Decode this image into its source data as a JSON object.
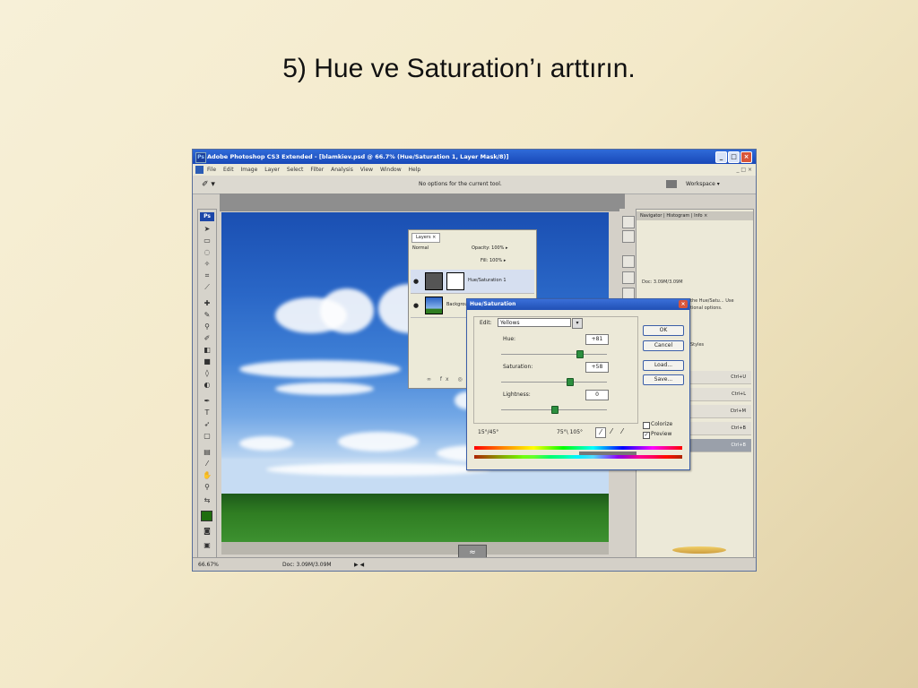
{
  "slide": {
    "title": "5) Hue ve Saturation’ı arttırın."
  },
  "app": {
    "title": "Adobe Photoshop CS3 Extended - [blamkiev.psd @ 66.7% (Hue/Saturation 1, Layer Mask/8)]",
    "logo": "Ps",
    "window_buttons": {
      "minimize": "_",
      "maximize": "□",
      "close": "×"
    },
    "menu": [
      "File",
      "Edit",
      "Image",
      "Layer",
      "Select",
      "Filter",
      "Analysis",
      "View",
      "Window",
      "Help"
    ],
    "menu_right": "_ □ ×",
    "options_hint": "No options for the current tool.",
    "workspace_label": "Workspace ▾",
    "tool_preset": "✐ ▾"
  },
  "status": {
    "zoom": "66.67%",
    "doc": "Doc: 3.09M/3.09M",
    "nav": "▶ ◀"
  },
  "scroll_handle": "≈",
  "layers_panel": {
    "tab": "Layers ×",
    "blend_mode": "Normal",
    "opacity_label": "Opacity: 100% ▸",
    "fill_label": "Fill: 100% ▸",
    "items": [
      {
        "name": "Hue/Saturation 1",
        "selected": true
      },
      {
        "name": "Background",
        "selected": false
      }
    ],
    "footer": "∞ fx ◎ ▣ ▤ ⌫"
  },
  "right_panel": {
    "tabs": "Navigator | Histogram | Info ×",
    "info_note": "Doc: 3.09M/3.09M",
    "hint_lines": [
      "the Hue/Satu... Use",
      "tional options."
    ],
    "styles_tab": "Styles",
    "shortcuts": [
      "Ctrl+U",
      "Ctrl+L",
      "Ctrl+M",
      "Ctrl+B",
      "Ctrl+B"
    ]
  },
  "hue_sat_dialog": {
    "title": "Hue/Saturation",
    "edit_label": "Edit:",
    "edit_value": "Yellows",
    "hue_label": "Hue:",
    "hue_value": "+81",
    "saturation_label": "Saturation:",
    "saturation_value": "+58",
    "lightness_label": "Lightness:",
    "lightness_value": "0",
    "hue_fraction": 0.74,
    "saturation_fraction": 0.64,
    "lightness_fraction": 0.5,
    "range_left": "15°/45°",
    "range_right": "75°\\ 105°",
    "buttons": {
      "ok": "OK",
      "cancel": "Cancel",
      "load": "Load...",
      "save": "Save..."
    },
    "colorize_label": "Colorize",
    "preview_label": "Preview",
    "colorize_checked": false,
    "preview_checked": true
  }
}
